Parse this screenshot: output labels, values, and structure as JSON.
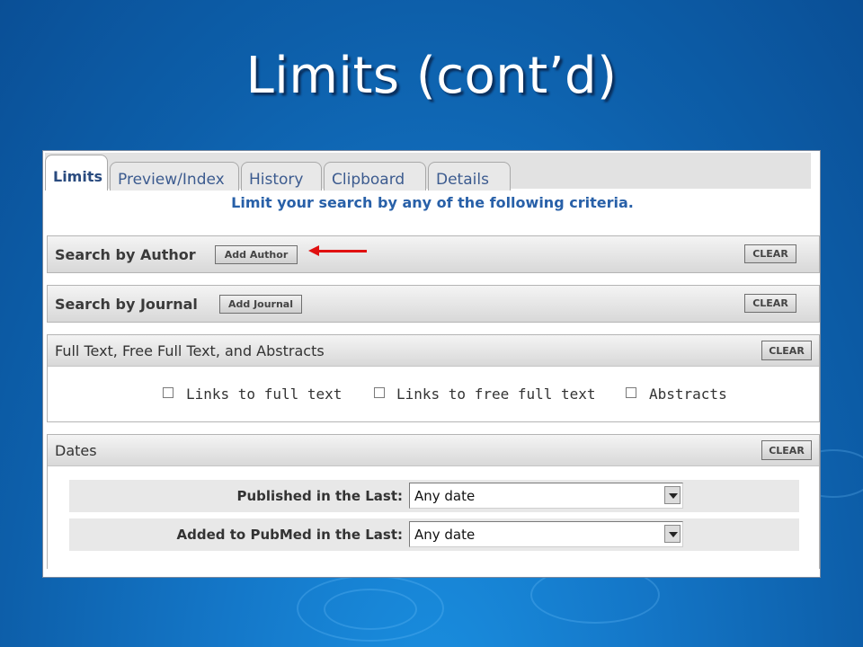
{
  "slide": {
    "title": "Limits (cont’d)"
  },
  "tabs": [
    "Limits",
    "Preview/Index",
    "History",
    "Clipboard",
    "Details"
  ],
  "subtitle": "Limit your search by any of the following criteria.",
  "author_section": {
    "title": "Search by Author",
    "add_button": "Add Author",
    "clear_button": "CLEAR"
  },
  "journal_section": {
    "title": "Search by Journal",
    "add_button": "Add Journal",
    "clear_button": "CLEAR"
  },
  "fulltext_section": {
    "title": "Full Text, Free Full Text, and Abstracts",
    "clear_button": "CLEAR",
    "options": [
      "Links to full text",
      "Links to free full text",
      "Abstracts"
    ]
  },
  "dates_section": {
    "title": "Dates",
    "clear_button": "CLEAR",
    "rows": [
      {
        "label": "Published in the Last:",
        "value": "Any date"
      },
      {
        "label": "Added to PubMed in the Last:",
        "value": "Any date"
      }
    ]
  },
  "colors": {
    "accent_arrow": "#e01010",
    "background": "#1477c8",
    "link_blue": "#2860a8"
  }
}
